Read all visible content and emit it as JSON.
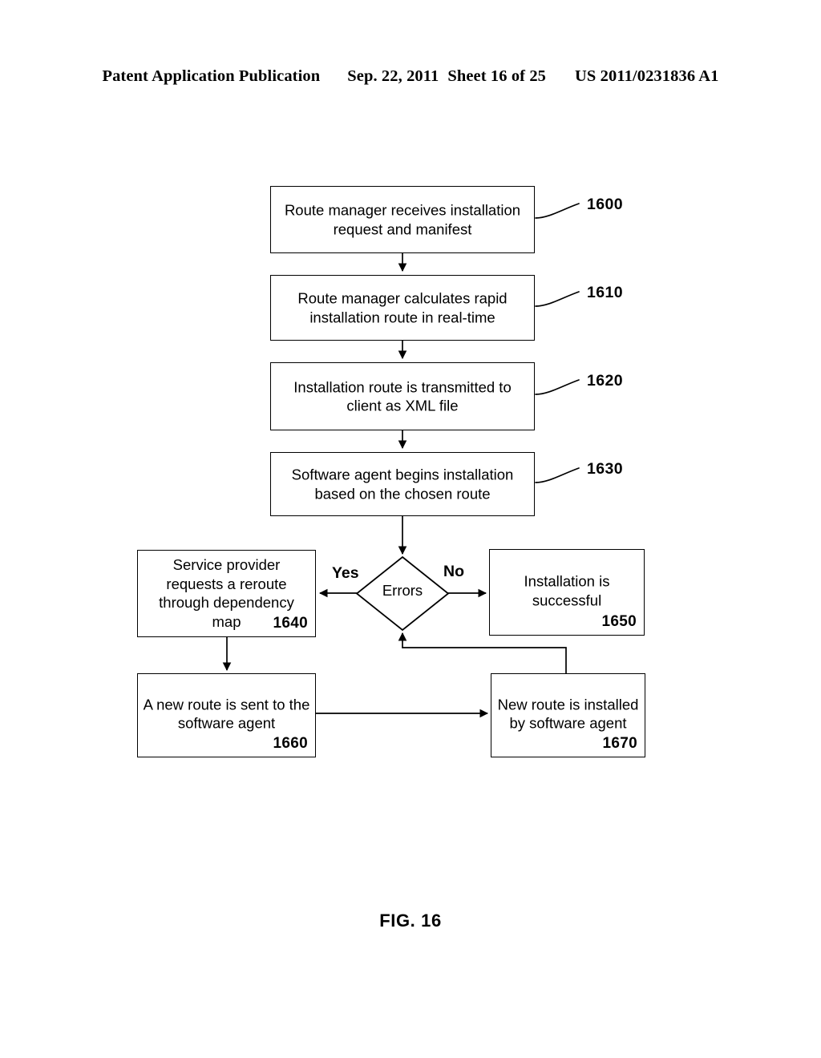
{
  "header": {
    "publication": "Patent Application Publication",
    "date": "Sep. 22, 2011",
    "sheet": "Sheet 16 of 25",
    "patent_number": "US 2011/0231836 A1"
  },
  "figure": {
    "caption": "FIG. 16"
  },
  "diagram": {
    "type": "flowchart",
    "nodes": [
      {
        "id": "1600",
        "shape": "process",
        "text": "Route manager receives installation request and manifest",
        "ref": "1600",
        "ref_placement": "external-right"
      },
      {
        "id": "1610",
        "shape": "process",
        "text": "Route manager calculates rapid installation route in real-time",
        "ref": "1610",
        "ref_placement": "external-right"
      },
      {
        "id": "1620",
        "shape": "process",
        "text": "Installation route is transmitted to client as XML file",
        "ref": "1620",
        "ref_placement": "external-right"
      },
      {
        "id": "1630",
        "shape": "process",
        "text": "Software agent begins installation based on the chosen route",
        "ref": "1630",
        "ref_placement": "external-right"
      },
      {
        "id": "1640",
        "shape": "process",
        "text": "Service provider requests a reroute through dependency map",
        "ref": "1640",
        "ref_placement": "inside-bottom-right"
      },
      {
        "id": "decision",
        "shape": "decision",
        "text": "Errors",
        "ref": null,
        "ref_placement": null
      },
      {
        "id": "1650",
        "shape": "process",
        "text": "Installation is successful",
        "ref": "1650",
        "ref_placement": "inside-bottom-right"
      },
      {
        "id": "1660",
        "shape": "process",
        "text": "A new route is sent to the software agent",
        "ref": "1660",
        "ref_placement": "inside-bottom-right"
      },
      {
        "id": "1670",
        "shape": "process",
        "text": "New route is installed by software agent",
        "ref": "1670",
        "ref_placement": "inside-bottom-right"
      }
    ],
    "edges": [
      {
        "from": "1600",
        "to": "1610",
        "label": ""
      },
      {
        "from": "1610",
        "to": "1620",
        "label": ""
      },
      {
        "from": "1620",
        "to": "1630",
        "label": ""
      },
      {
        "from": "1630",
        "to": "decision",
        "label": ""
      },
      {
        "from": "decision",
        "to": "1640",
        "label": "Yes"
      },
      {
        "from": "decision",
        "to": "1650",
        "label": "No"
      },
      {
        "from": "1640",
        "to": "1660",
        "label": ""
      },
      {
        "from": "1660",
        "to": "1670",
        "label": ""
      },
      {
        "from": "1670",
        "to": "decision",
        "label": ""
      }
    ],
    "branch_labels": {
      "yes": "Yes",
      "no": "No"
    },
    "colors": {
      "stroke": "#000000",
      "fill": "#ffffff",
      "text": "#000000"
    }
  }
}
